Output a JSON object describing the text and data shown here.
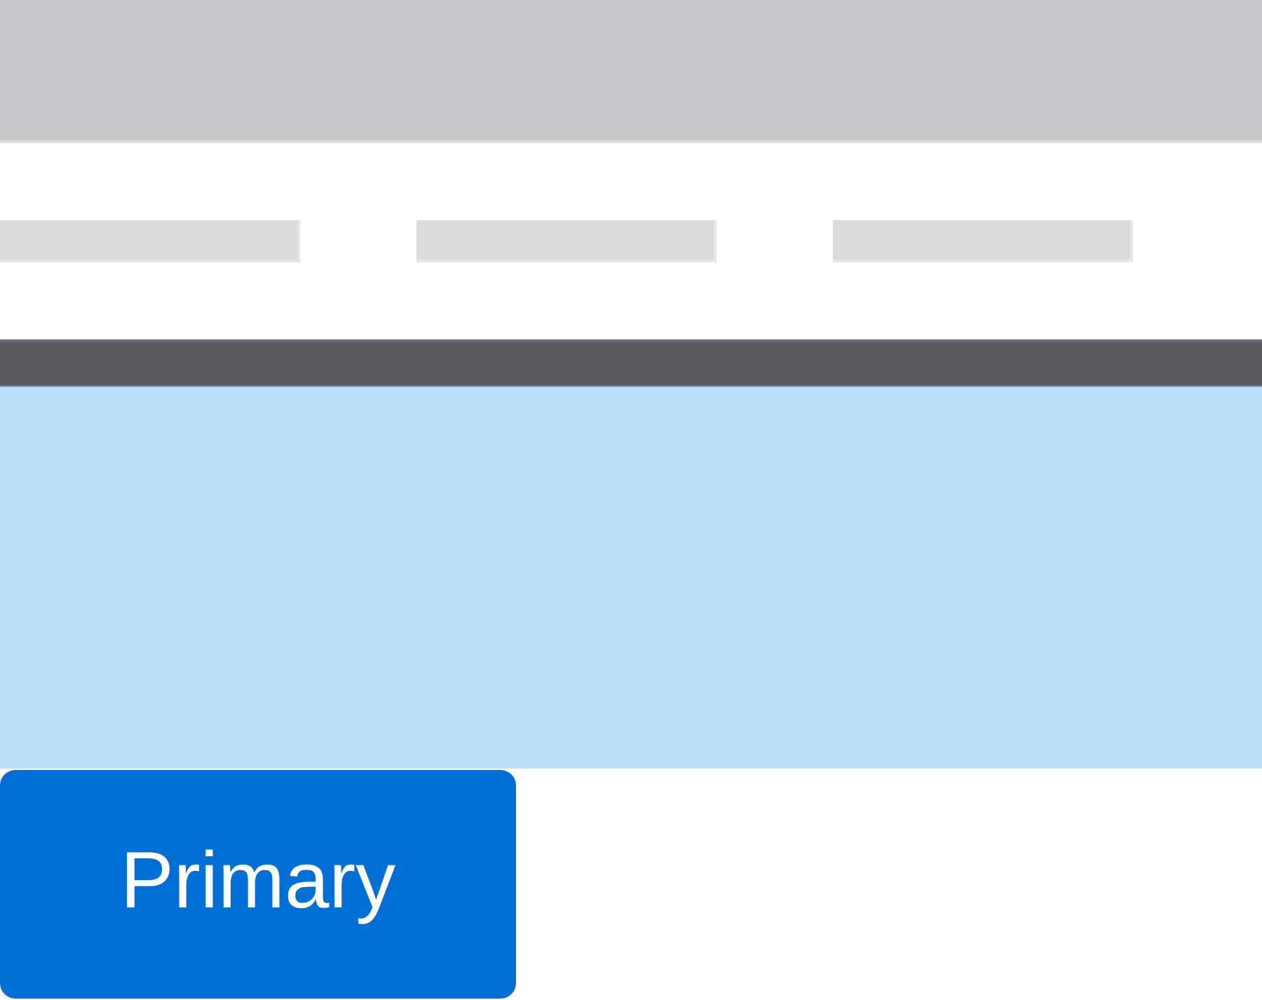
{
  "placeholder_row": [
    {
      "kind": "bar"
    },
    {
      "kind": "bar"
    },
    {
      "kind": "bar"
    }
  ],
  "button": {
    "kind": "primary",
    "label": "Primary"
  }
}
